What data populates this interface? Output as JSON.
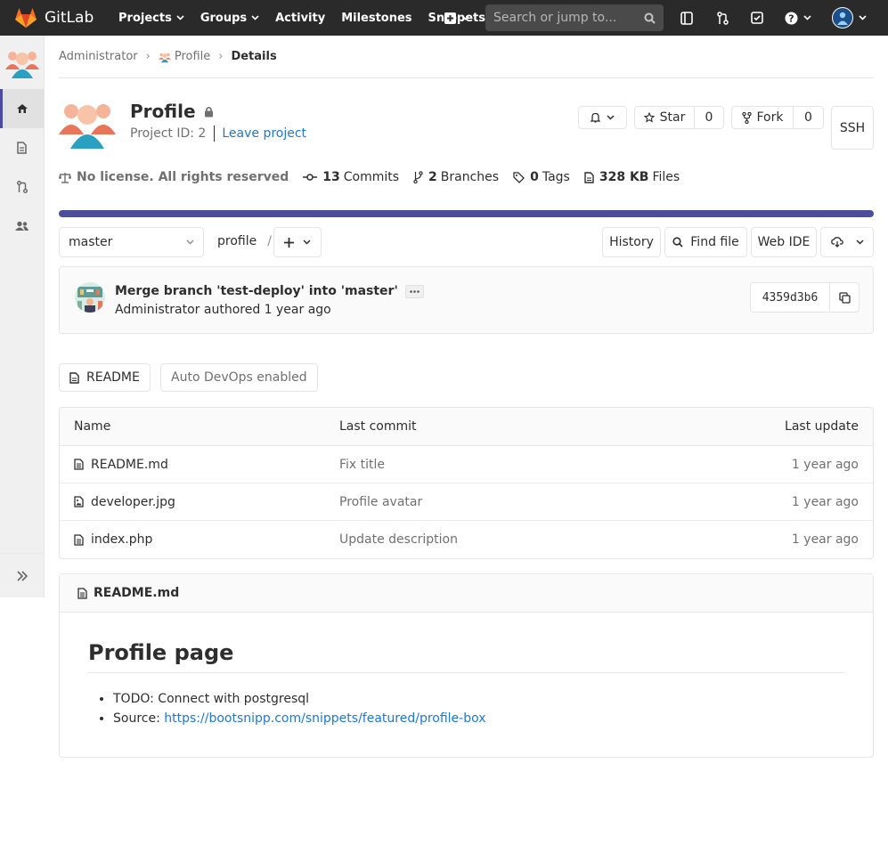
{
  "navbar": {
    "brand": "GitLab",
    "items": [
      {
        "label": "Projects",
        "dropdown": true
      },
      {
        "label": "Groups",
        "dropdown": true
      },
      {
        "label": "Activity",
        "dropdown": false
      },
      {
        "label": "Milestones",
        "dropdown": false
      },
      {
        "label": "Snippets",
        "dropdown": false
      }
    ],
    "search_placeholder": "Search or jump to..."
  },
  "breadcrumb": [
    "Administrator",
    "Profile",
    "Details"
  ],
  "project": {
    "name": "Profile",
    "id_text": "Project ID: 2",
    "leave": "Leave project",
    "star_label": "Star",
    "star_count": "0",
    "fork_label": "Fork",
    "fork_count": "0",
    "clone_label": "SSH"
  },
  "stats": {
    "license": "No license. All rights reserved",
    "commits_n": "13",
    "commits_label": "Commits",
    "branches_n": "2",
    "branches_label": "Branches",
    "tags_n": "0",
    "tags_label": "Tags",
    "size_n": "328 KB",
    "size_label": "Files"
  },
  "repo": {
    "branch": "master",
    "path": "profile",
    "history": "History",
    "find_file": "Find file",
    "web_ide": "Web IDE"
  },
  "last_commit": {
    "message": "Merge branch 'test-deploy' into 'master'",
    "meta": "Administrator authored 1 year ago",
    "sha": "4359d3b6"
  },
  "pills": {
    "readme": "README",
    "autodevops": "Auto DevOps enabled"
  },
  "tree": {
    "headers": {
      "name": "Name",
      "last_commit": "Last commit",
      "last_update": "Last update"
    },
    "rows": [
      {
        "name": "README.md",
        "commit": "Fix title",
        "updated": "1 year ago"
      },
      {
        "name": "developer.jpg",
        "commit": "Profile avatar",
        "updated": "1 year ago"
      },
      {
        "name": "index.php",
        "commit": "Update description",
        "updated": "1 year ago"
      }
    ]
  },
  "readme": {
    "file": "README.md",
    "heading": "Profile page",
    "item1": "TODO: Connect with postgresql",
    "item2_prefix": "Source: ",
    "item2_link": "https://bootsnipp.com/snippets/featured/profile-box"
  },
  "colors": {
    "navbar": "#2a2a2a",
    "accent": "#4b4f99",
    "link": "#1f78d1"
  }
}
